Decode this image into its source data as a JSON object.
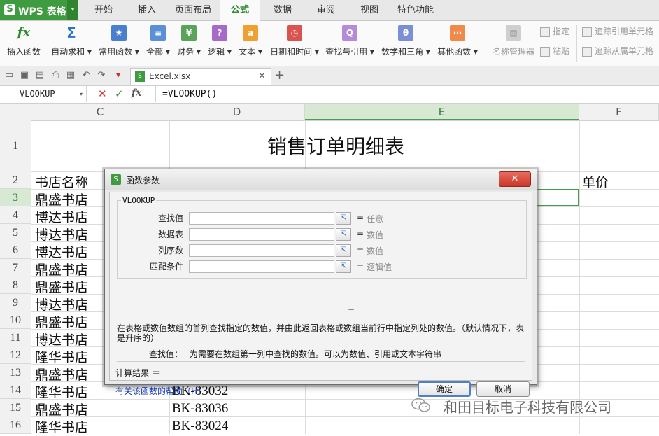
{
  "app": {
    "logo_mark": "S",
    "name": "WPS 表格",
    "dropdown": "▾"
  },
  "tabs": [
    {
      "label": "开始"
    },
    {
      "label": "插入"
    },
    {
      "label": "页面布局"
    },
    {
      "label": "公式",
      "active": true
    },
    {
      "label": "数据"
    },
    {
      "label": "审阅"
    },
    {
      "label": "视图"
    },
    {
      "label": "特色功能"
    }
  ],
  "ribbon": {
    "buttons": [
      {
        "label": "插入函数",
        "icon": "fx-icon",
        "glyph": "fx",
        "color": "#ffffff",
        "text": "#2f8a2f"
      },
      {
        "label": "自动求和 ▾",
        "icon": "sigma-icon",
        "glyph": "Σ",
        "color": "#ffffff",
        "text": "#2a73c9"
      },
      {
        "label": "常用函数 ▾",
        "icon": "star-book-icon",
        "glyph": "★",
        "color": "#4a7fd0"
      },
      {
        "label": "全部 ▾",
        "icon": "all-book-icon",
        "glyph": "≡",
        "color": "#5b8fd6"
      },
      {
        "label": "财务 ▾",
        "icon": "finance-book-icon",
        "glyph": "¥",
        "color": "#5aa35a"
      },
      {
        "label": "逻辑 ▾",
        "icon": "logic-book-icon",
        "glyph": "?",
        "color": "#a66bc9"
      },
      {
        "label": "文本 ▾",
        "icon": "text-book-icon",
        "glyph": "a",
        "color": "#f0a030"
      },
      {
        "label": "日期和时间 ▾",
        "icon": "clock-book-icon",
        "glyph": "◷",
        "color": "#d9534f"
      },
      {
        "label": "查找与引用 ▾",
        "icon": "lookup-book-icon",
        "glyph": "Q",
        "color": "#b58ad8"
      },
      {
        "label": "数学和三角 ▾",
        "icon": "math-book-icon",
        "glyph": "θ",
        "color": "#7a8fd6"
      },
      {
        "label": "其他函数 ▾",
        "icon": "more-book-icon",
        "glyph": "⋯",
        "color": "#f08a4a"
      },
      {
        "label": "名称管理器",
        "icon": "name-manager-icon",
        "glyph": "▤",
        "color": "#bdbdbd",
        "disabled": true
      }
    ],
    "small": {
      "assign": "指定",
      "paste": "粘贴",
      "trace_precedents": "追踪引用单元格",
      "trace_dependents": "追踪从属单元格"
    }
  },
  "doc_tab": {
    "file": "Excel.xlsx",
    "close": "×",
    "new": "+",
    "file_icon": "S"
  },
  "formula_bar": {
    "name_box": "VLOOKUP",
    "cancel": "✕",
    "confirm": "✓",
    "fx": "fx",
    "content": "=VLOOKUP()"
  },
  "columns": [
    "C",
    "D",
    "E",
    "F"
  ],
  "rows": [
    "1",
    "2",
    "3",
    "4",
    "5",
    "6",
    "7",
    "8",
    "9",
    "10",
    "11",
    "12",
    "13",
    "14",
    "15",
    "16"
  ],
  "sheet": {
    "title": "销售订单明细表",
    "header_c": "书店名称",
    "header_f": "单价",
    "stores": [
      "鼎盛书店",
      "博达书店",
      "博达书店",
      "博达书店",
      "鼎盛书店",
      "鼎盛书店",
      "博达书店",
      "鼎盛书店",
      "博达书店",
      "隆华书店",
      "鼎盛书店",
      "隆华书店",
      "鼎盛书店",
      "隆华书店"
    ],
    "codes": [
      "BK-83032",
      "BK-83036",
      "BK-83024"
    ]
  },
  "dialog": {
    "title": "函数参数",
    "close": "✕",
    "group": "VLOOKUP",
    "params": [
      {
        "label": "查找值",
        "eq": "=",
        "value": "任意"
      },
      {
        "label": "数据表",
        "eq": "=",
        "value": "数值"
      },
      {
        "label": "列序数",
        "eq": "=",
        "value": "数值"
      },
      {
        "label": "匹配条件",
        "eq": "=",
        "value": "逻辑值"
      }
    ],
    "ref_button": "⇱",
    "result_eq": "=",
    "description": "在表格或数值数组的首列查找指定的数值，并由此返回表格或数组当前行中指定列处的数值。（默认情况下，表是升序的）",
    "param_desc_label": "查找值：",
    "param_desc_text": "为需要在数组第一列中查找的数值。可以为数值、引用或文本字符串",
    "calc_result": "计算结果 ＝",
    "help_link": "有关该函数的帮助（H）",
    "ok": "确定",
    "cancel": "取消"
  },
  "watermark": {
    "text": "和田目标电子科技有限公司",
    "icon": "wechat-icon"
  }
}
